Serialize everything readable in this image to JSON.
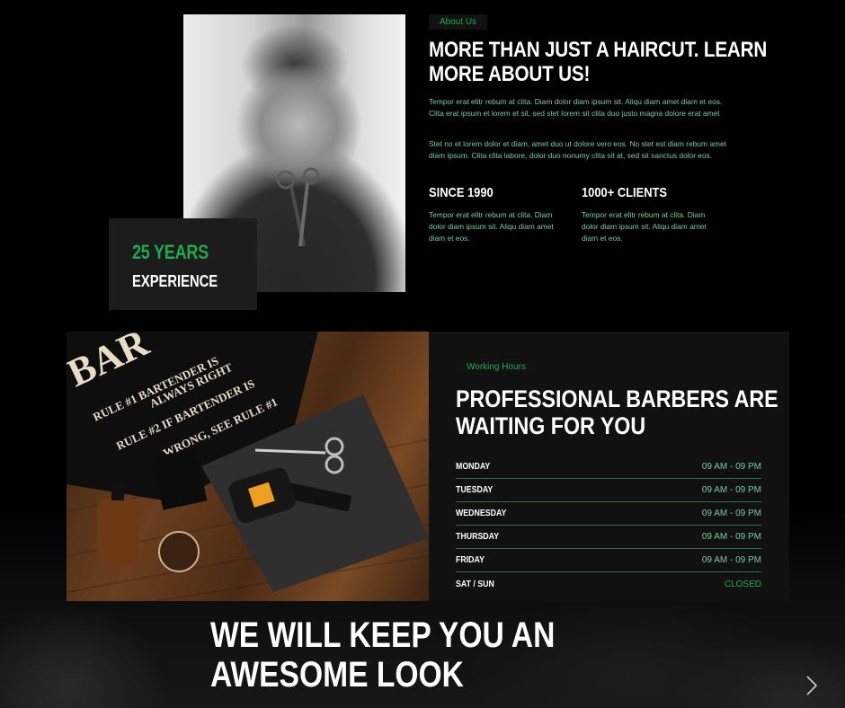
{
  "about": {
    "badge": "About Us",
    "title_line1": "MORE THAN JUST A HAIRCUT. LEARN",
    "title_line2": "MORE ABOUT US!",
    "paragraph1": "Tempor erat elitr rebum at clita. Diam dolor diam ipsum sit. Aliqu diam amet diam et eos. Clita erat ipsum et lorem et sit, sed stet lorem sit clita duo justo magna dolore erat amet",
    "paragraph2": "Stet no et lorem dolor et diam, amet duo ut dolore vero eos. No stet est diam rebum amet diam ipsum. Clita clita labore, dolor duo nonumy clita sit at, sed sit sanctus dolor eos.",
    "experience": {
      "years": "25 YEARS",
      "label": "EXPERIENCE"
    },
    "stats": [
      {
        "title": "SINCE 1990",
        "text": "Tempor erat elitr rebum at clita. Diam dolor diam ipsum sit. Aliqu diam amet diam et eos."
      },
      {
        "title": "1000+ CLIENTS",
        "text": "Tempor erat elitr rebum at clita. Diam dolor diam ipsum sit. Aliqu diam amet diam et eos."
      }
    ]
  },
  "hours": {
    "badge": "Working Hours",
    "title_line1": "PROFESSIONAL BARBERS ARE",
    "title_line2": "WAITING FOR YOU",
    "rows": [
      {
        "day": "MONDAY",
        "time": "09 AM - 09 PM"
      },
      {
        "day": "TUESDAY",
        "time": "09 AM - 09 PM"
      },
      {
        "day": "WEDNESDAY",
        "time": "09 AM - 09 PM"
      },
      {
        "day": "THURSDAY",
        "time": "09 AM - 09 PM"
      },
      {
        "day": "FRIDAY",
        "time": "09 AM - 09 PM"
      },
      {
        "day": "SAT / SUN",
        "time": "CLOSED"
      }
    ],
    "photo_sign": {
      "line1": "BAR",
      "line2": "RULE #1 BARTENDER IS",
      "line3": "ALWAYS RIGHT",
      "line4": "RULE #2 IF BARTENDER IS",
      "line5": "WRONG, SEE RULE #1"
    }
  },
  "hero": {
    "title_line1": "WE WILL KEEP YOU AN",
    "title_line2": "AWESOME LOOK"
  },
  "colors": {
    "accent": "#1faa4e",
    "muted_text": "#79c9a0",
    "panel": "#111111",
    "background": "#000000"
  }
}
